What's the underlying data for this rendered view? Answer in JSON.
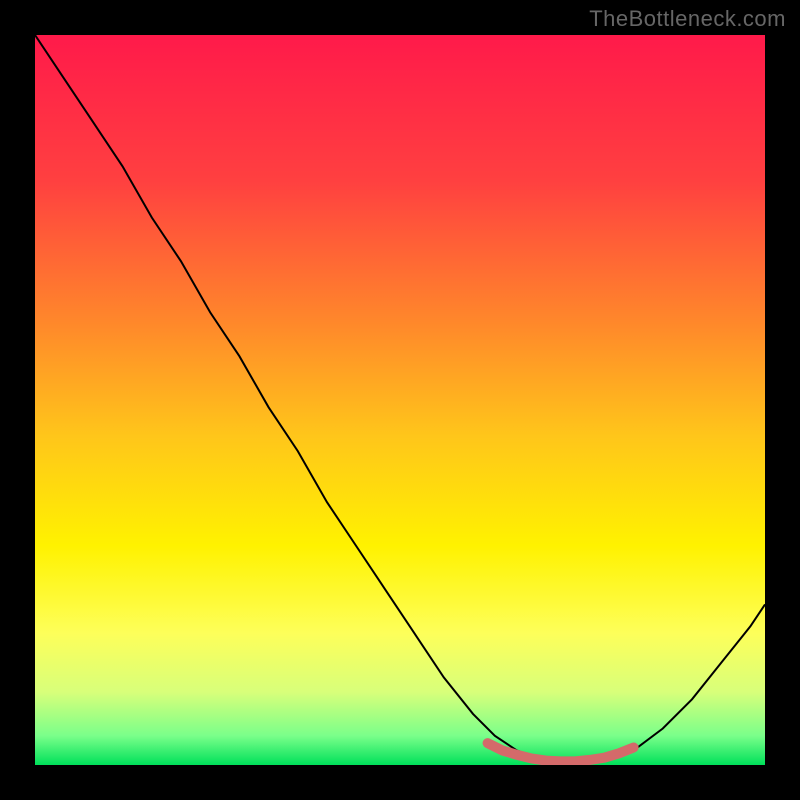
{
  "watermark": "TheBottleneck.com",
  "chart_data": {
    "type": "line",
    "title": "",
    "xlabel": "",
    "ylabel": "",
    "xlim": [
      0,
      100
    ],
    "ylim": [
      0,
      100
    ],
    "background_gradient": {
      "stops": [
        {
          "offset": 0,
          "color": "#ff1a4a"
        },
        {
          "offset": 20,
          "color": "#ff4040"
        },
        {
          "offset": 40,
          "color": "#ff8a2a"
        },
        {
          "offset": 55,
          "color": "#ffc61a"
        },
        {
          "offset": 70,
          "color": "#fff200"
        },
        {
          "offset": 82,
          "color": "#fdff5a"
        },
        {
          "offset": 90,
          "color": "#d8ff7a"
        },
        {
          "offset": 96,
          "color": "#7aff8a"
        },
        {
          "offset": 100,
          "color": "#00e05a"
        }
      ]
    },
    "series": [
      {
        "name": "curve",
        "color": "#000000",
        "width": 2,
        "x": [
          0,
          4,
          8,
          12,
          16,
          20,
          24,
          28,
          32,
          36,
          40,
          44,
          48,
          52,
          56,
          60,
          63,
          66,
          70,
          74,
          78,
          82,
          86,
          90,
          94,
          98,
          100
        ],
        "y": [
          100,
          94,
          88,
          82,
          75,
          69,
          62,
          56,
          49,
          43,
          36,
          30,
          24,
          18,
          12,
          7,
          4,
          2,
          0.5,
          0.3,
          0.5,
          2,
          5,
          9,
          14,
          19,
          22
        ]
      }
    ],
    "highlight_segment": {
      "name": "optimal-band",
      "color": "#d46a6a",
      "width": 10,
      "x": [
        62,
        64,
        66,
        68,
        70,
        72,
        74,
        76,
        78,
        80,
        82
      ],
      "y": [
        3.0,
        2.0,
        1.4,
        0.9,
        0.6,
        0.5,
        0.5,
        0.7,
        1.0,
        1.6,
        2.4
      ]
    }
  }
}
